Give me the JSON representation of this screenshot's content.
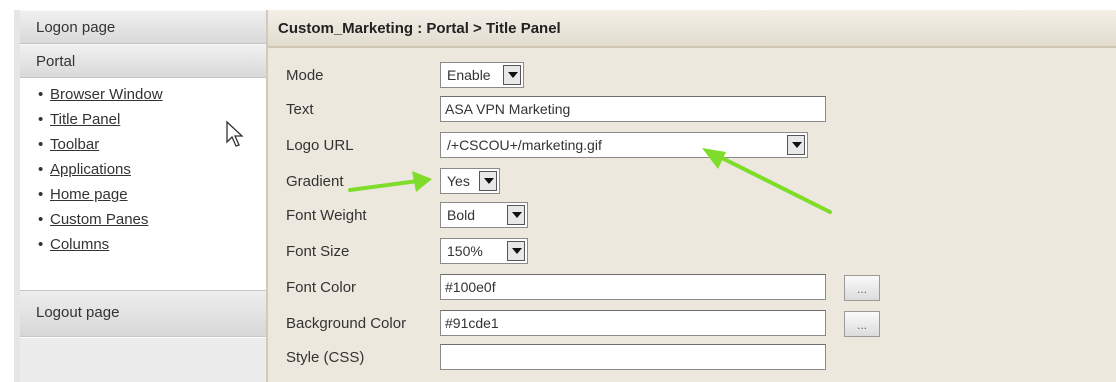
{
  "sidebar": {
    "logon_label": "Logon page",
    "portal_label": "Portal",
    "items": [
      {
        "label": "Browser Window"
      },
      {
        "label": "Title Panel"
      },
      {
        "label": "Toolbar"
      },
      {
        "label": "Applications"
      },
      {
        "label": "Home page"
      },
      {
        "label": "Custom Panes"
      },
      {
        "label": "Columns"
      }
    ],
    "logout_label": "Logout page"
  },
  "panel": {
    "title": "Custom_Marketing : Portal > Title Panel",
    "fields": {
      "mode": {
        "label": "Mode",
        "value": "Enable"
      },
      "text": {
        "label": "Text",
        "value": "ASA VPN Marketing"
      },
      "logo_url": {
        "label": "Logo URL",
        "value": "/+CSCOU+/marketing.gif"
      },
      "gradient": {
        "label": "Gradient",
        "value": "Yes"
      },
      "font_weight": {
        "label": "Font Weight",
        "value": "Bold"
      },
      "font_size": {
        "label": "Font Size",
        "value": "150%"
      },
      "font_color": {
        "label": "Font Color",
        "value": "#100e0f",
        "button": "..."
      },
      "background_color": {
        "label": "Background Color",
        "value": "#91cde1",
        "button": "..."
      },
      "style_css": {
        "label": "Style (CSS)",
        "value": ""
      }
    }
  },
  "colors": {
    "panel_bg": "#ede8de",
    "highlight_arrow": "#7fdc2a"
  },
  "icons": [
    "mouse-pointer-icon",
    "green-arrow-icon",
    "dropdown-arrow-icon"
  ]
}
